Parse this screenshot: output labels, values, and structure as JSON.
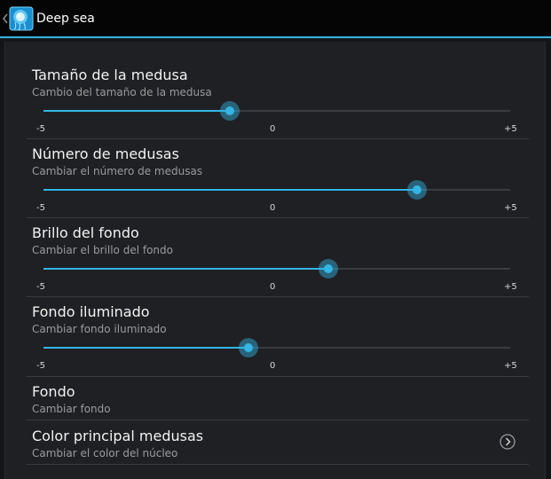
{
  "action_bar": {
    "title": "Deep sea",
    "accent_color": "#33b5e5",
    "up_icon": "chevron-left-icon",
    "app_icon": "jellyfish-app-icon"
  },
  "settings": {
    "sliders": [
      {
        "title": "Tamaño de la medusa",
        "summary": "Cambio del tamaño de la medusa",
        "min_label": "-5",
        "mid_label": "0",
        "max_label": "+5",
        "value": -1.0
      },
      {
        "title": "Número de medusas",
        "summary": "Cambiar el número de medusas",
        "min_label": "-5",
        "mid_label": "0",
        "max_label": "+5",
        "value": 3.0
      },
      {
        "title": "Brillo del fondo",
        "summary": "Cambiar el brillo del fondo",
        "min_label": "-5",
        "mid_label": "0",
        "max_label": "+5",
        "value": 1.1
      },
      {
        "title": "Fondo iluminado",
        "summary": "Cambiar fondo iluminado",
        "min_label": "-5",
        "mid_label": "0",
        "max_label": "+5",
        "value": -0.6
      }
    ],
    "items": [
      {
        "title": "Fondo",
        "summary": "Cambiar fondo"
      },
      {
        "title": "Color principal medusas",
        "summary": "Cambiar el color del núcleo",
        "icon": "chevron-right-circle-icon"
      }
    ],
    "slider_range": [
      -5,
      5
    ]
  }
}
